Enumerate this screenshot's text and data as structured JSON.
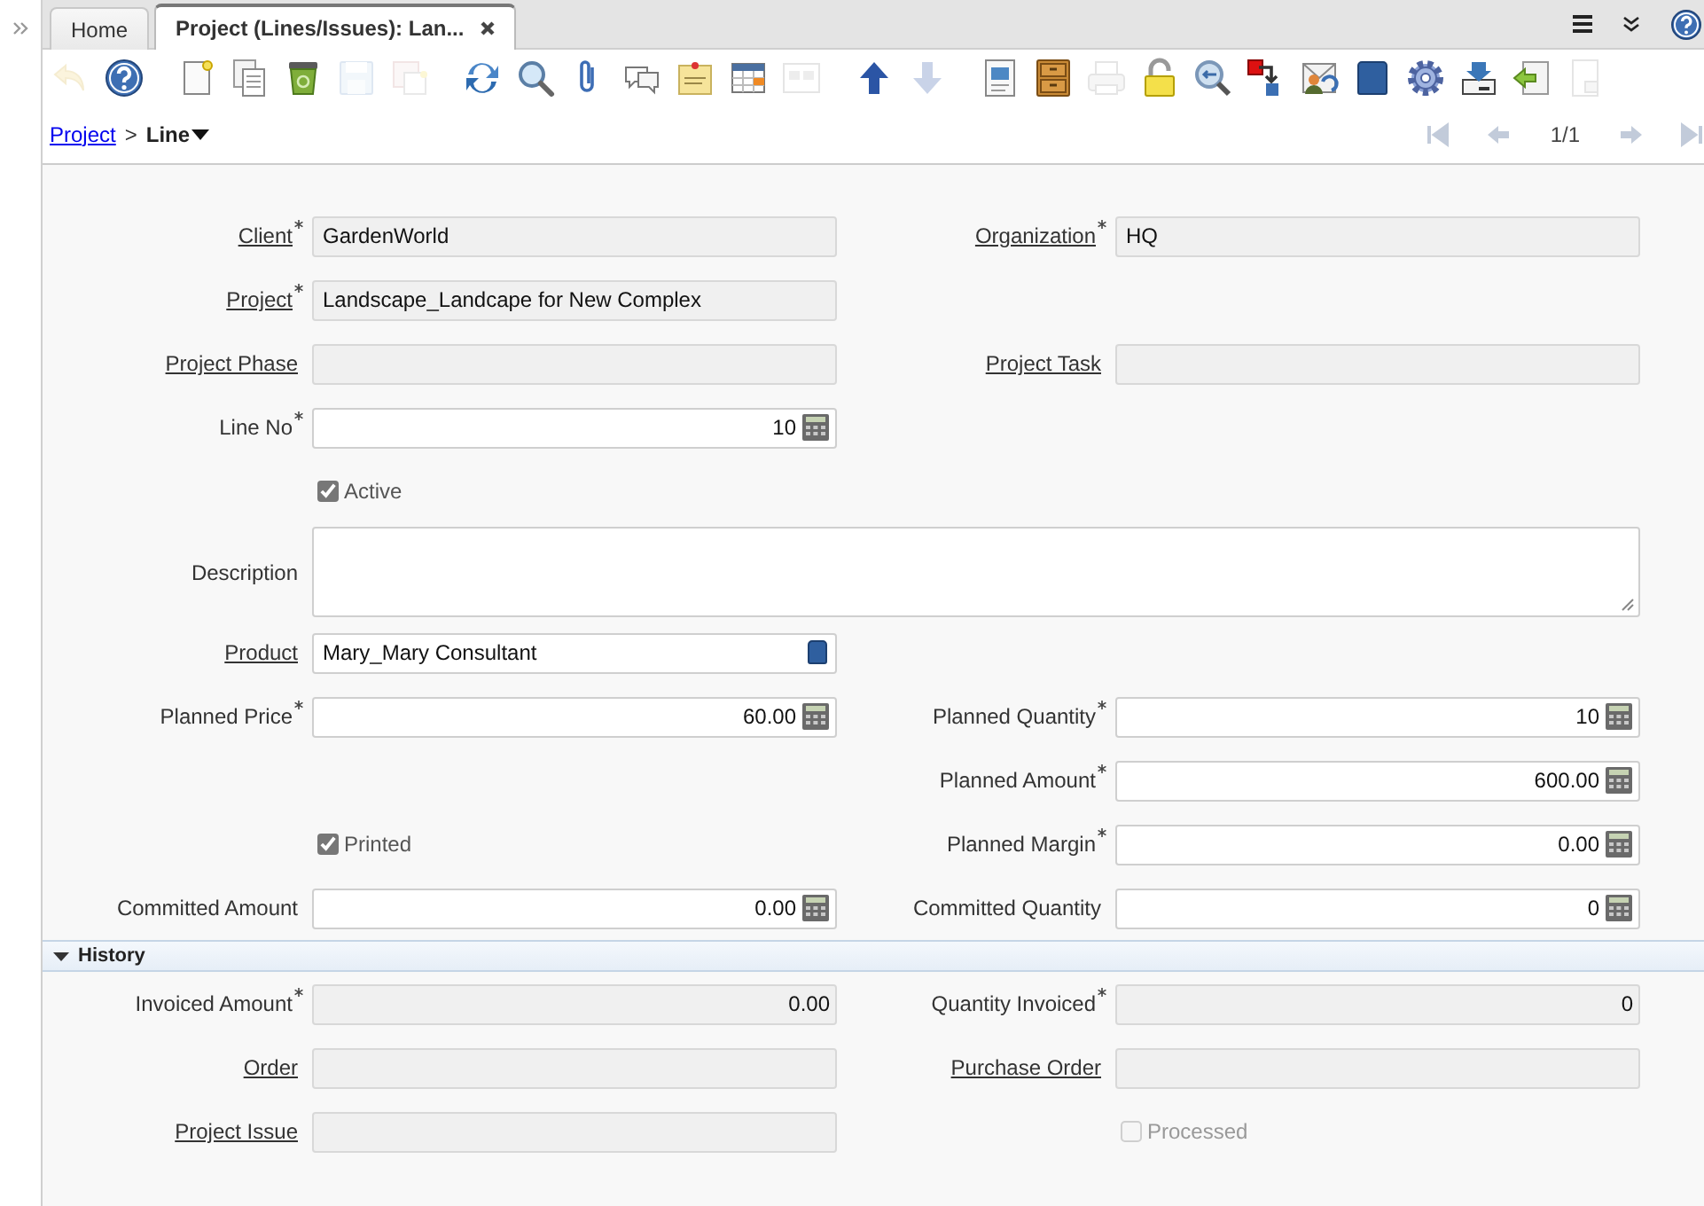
{
  "tabs": [
    {
      "label": "Home",
      "selected": false,
      "closable": false
    },
    {
      "label": "Project (Lines/Issues): Lan...",
      "selected": true,
      "closable": true
    }
  ],
  "toolbar": [
    {
      "kind": "undo",
      "disabled": true
    },
    {
      "kind": "help",
      "disabled": false
    },
    {
      "kind": "new",
      "disabled": false
    },
    {
      "kind": "copy",
      "disabled": false
    },
    {
      "kind": "delete",
      "disabled": false
    },
    {
      "kind": "save",
      "disabled": true
    },
    {
      "kind": "save-new",
      "disabled": true
    },
    {
      "kind": "refresh",
      "disabled": false
    },
    {
      "kind": "find",
      "disabled": false
    },
    {
      "kind": "attach",
      "disabled": false
    },
    {
      "kind": "chat",
      "disabled": false
    },
    {
      "kind": "note",
      "disabled": false
    },
    {
      "kind": "grid",
      "disabled": false
    },
    {
      "kind": "split",
      "disabled": true
    },
    {
      "kind": "up",
      "disabled": false
    },
    {
      "kind": "down",
      "disabled": true
    },
    {
      "kind": "report",
      "disabled": false
    },
    {
      "kind": "archive",
      "disabled": false
    },
    {
      "kind": "print",
      "disabled": true
    },
    {
      "kind": "lock",
      "disabled": false
    },
    {
      "kind": "zoom",
      "disabled": false
    },
    {
      "kind": "workflow",
      "disabled": false
    },
    {
      "kind": "request",
      "disabled": false
    },
    {
      "kind": "product",
      "disabled": false
    },
    {
      "kind": "process",
      "disabled": false
    },
    {
      "kind": "export",
      "disabled": false
    },
    {
      "kind": "import",
      "disabled": false
    },
    {
      "kind": "post",
      "disabled": true
    }
  ],
  "breadcrumb": {
    "parent": "Project",
    "separator": ">",
    "current": "Line",
    "record": "1/1",
    "nav": [
      {
        "kind": "first",
        "disabled": true
      },
      {
        "kind": "previous",
        "disabled": true
      },
      {
        "kind": "next",
        "disabled": true
      },
      {
        "kind": "last",
        "disabled": true
      }
    ]
  },
  "sections": [
    {
      "rows": [
        {
          "left": {
            "kind": "text",
            "label": "Client",
            "link": true,
            "mandatory": true,
            "readonly": true,
            "value": "GardenWorld"
          },
          "right": {
            "kind": "text",
            "label": "Organization",
            "link": true,
            "mandatory": true,
            "readonly": true,
            "value": "HQ"
          }
        },
        {
          "left": {
            "kind": "text",
            "label": "Project",
            "link": true,
            "mandatory": true,
            "readonly": true,
            "value": "Landscape_Landcape for New Complex"
          }
        },
        {
          "left": {
            "kind": "text",
            "label": "Project Phase",
            "link": true,
            "mandatory": false,
            "readonly": true
          },
          "right": {
            "kind": "text",
            "label": "Project Task",
            "link": true,
            "mandatory": false,
            "readonly": true
          }
        },
        {
          "left": {
            "kind": "number",
            "label": "Line No",
            "link": false,
            "mandatory": true,
            "readonly": false,
            "value": "10"
          }
        },
        {
          "left": {
            "kind": "checkbox",
            "label": "Active",
            "checked": true,
            "disabled": false
          }
        },
        {
          "left": {
            "kind": "textarea",
            "label": "Description",
            "link": false,
            "mandatory": false,
            "readonly": false
          }
        },
        {
          "left": {
            "kind": "search",
            "label": "Product",
            "link": true,
            "mandatory": false,
            "readonly": false,
            "value": "Mary_Mary Consultant"
          }
        },
        {
          "left": {
            "kind": "number",
            "label": "Planned Price",
            "link": false,
            "mandatory": true,
            "readonly": false,
            "value": "60.00"
          },
          "right": {
            "kind": "number",
            "label": "Planned Quantity",
            "link": false,
            "mandatory": true,
            "readonly": false,
            "value": "10"
          }
        },
        {
          "right": {
            "kind": "number",
            "label": "Planned Amount",
            "link": false,
            "mandatory": true,
            "readonly": false,
            "value": "600.00"
          }
        },
        {
          "left": {
            "kind": "checkbox",
            "label": "Printed",
            "checked": true,
            "disabled": false
          },
          "right": {
            "kind": "number",
            "label": "Planned Margin",
            "link": false,
            "mandatory": true,
            "readonly": false,
            "value": "0.00"
          }
        },
        {
          "left": {
            "kind": "number",
            "label": "Committed Amount",
            "link": false,
            "mandatory": false,
            "readonly": false,
            "value": "0.00"
          },
          "right": {
            "kind": "number",
            "label": "Committed Quantity",
            "link": false,
            "mandatory": false,
            "readonly": false,
            "value": "0"
          }
        }
      ]
    },
    {
      "title": "History",
      "expanded": true,
      "rows": [
        {
          "left": {
            "kind": "number",
            "label": "Invoiced Amount",
            "link": false,
            "mandatory": true,
            "readonly": true,
            "value": "0.00"
          },
          "right": {
            "kind": "number",
            "label": "Quantity Invoiced",
            "link": false,
            "mandatory": true,
            "readonly": true,
            "value": "0"
          }
        },
        {
          "left": {
            "kind": "text",
            "label": "Order",
            "link": true,
            "mandatory": false,
            "readonly": true
          },
          "right": {
            "kind": "text",
            "label": "Purchase Order",
            "link": true,
            "mandatory": false,
            "readonly": true
          }
        },
        {
          "left": {
            "kind": "text",
            "label": "Project Issue",
            "link": true,
            "mandatory": false,
            "readonly": true
          },
          "right": {
            "kind": "checkbox",
            "label": "Processed",
            "checked": false,
            "disabled": true
          }
        }
      ]
    }
  ]
}
